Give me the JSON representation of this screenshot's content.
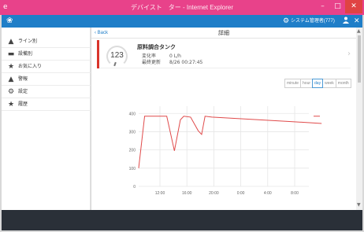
{
  "window": {
    "title": "デバイスト　ター - Internet Explorer",
    "minimize": "–",
    "maximize": "□",
    "close": "✕"
  },
  "appbar": {
    "logo": "❀",
    "gear": "⚙",
    "admin_label": "システム管理者(777)",
    "user_icon": "👤",
    "close": "✕"
  },
  "sidebar": {
    "items": [
      {
        "icon": "▲",
        "icon_name": "warning-icon",
        "label": "ライン別"
      },
      {
        "icon": "▬",
        "icon_name": "equipment-icon",
        "label": "設備別"
      },
      {
        "icon": "★",
        "icon_name": "star-icon",
        "label": "お気に入り"
      },
      {
        "icon": "▲",
        "icon_name": "alert-icon",
        "label": "警報"
      },
      {
        "icon": "⚙",
        "icon_name": "gear-icon",
        "label": "設定"
      },
      {
        "icon": "★",
        "icon_name": "history-icon",
        "label": "履歴"
      }
    ]
  },
  "main": {
    "back_label": "‹ Back",
    "title": "詳細"
  },
  "device": {
    "value": "123",
    "name": "原料調合タンク",
    "fields": [
      {
        "label": "変化率",
        "value": "0 L/h"
      },
      {
        "label": "最終更新",
        "value": "8/26 00:27:45"
      }
    ],
    "accent_color": "#d9342b"
  },
  "periods": {
    "options": [
      "minute",
      "hour",
      "day",
      "week",
      "month"
    ],
    "selected": "day"
  },
  "chart_data": {
    "type": "line",
    "x_tick_labels": [
      "12:00",
      "16:00",
      "20:00",
      "0:00",
      "4:00",
      "8:00"
    ],
    "y_ticks": [
      0,
      100,
      200,
      300,
      400
    ],
    "ylim": [
      0,
      440
    ],
    "x": [
      0,
      0.7,
      3.3,
      4.2,
      4.9,
      5.3,
      6.1,
      7.0,
      7.4,
      7.8,
      8.6,
      18.1,
      21.5
    ],
    "series": [
      {
        "values": [
          100,
          385,
          385,
          195,
          365,
          385,
          380,
          305,
          285,
          385,
          380,
          355,
          345
        ],
        "color": "#e04a4a"
      }
    ],
    "grid": true
  },
  "footer": {}
}
